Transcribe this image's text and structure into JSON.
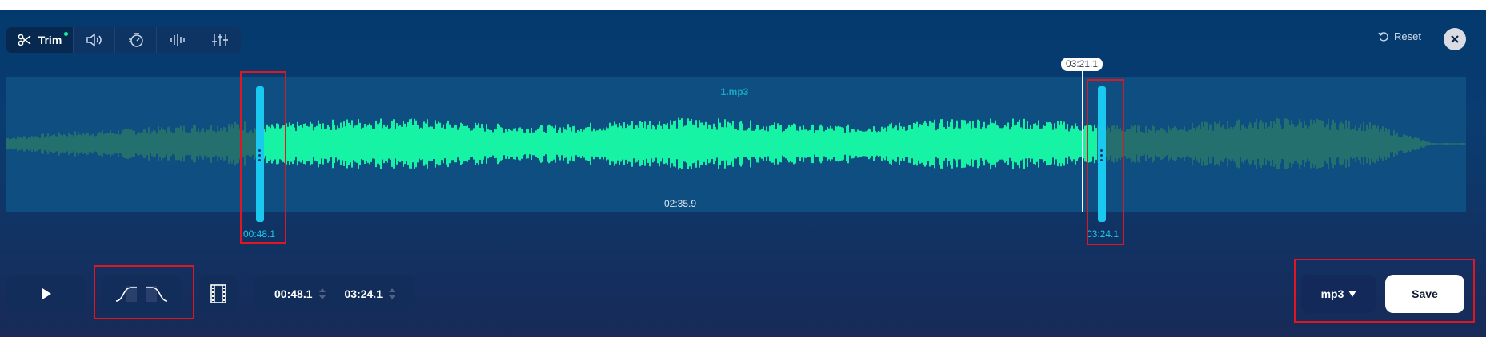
{
  "toolbar": {
    "trim_label": "Trim",
    "icons": [
      "scissors-icon",
      "volume-icon",
      "speed-icon",
      "equalizer-bars-icon",
      "sliders-icon"
    ]
  },
  "header": {
    "reset_label": "Reset",
    "close_icon": "close-icon"
  },
  "track": {
    "file_name": "1.mp3",
    "selection_duration": "02:35.9",
    "start_time": "00:48.1",
    "end_time": "03:24.1",
    "playhead_time": "03:21.1"
  },
  "controls": {
    "play_icon": "play-icon",
    "fade_in_icon": "fade-in-icon",
    "fade_out_icon": "fade-out-icon",
    "film_icon": "film-icon",
    "start_value": "00:48.1",
    "end_value": "03:24.1"
  },
  "export": {
    "format": "mp3",
    "save_label": "Save"
  },
  "colors": {
    "accent": "#19c9ef",
    "wave_selected": "#16f3a4",
    "wave_unselected": "#24706e",
    "highlight_box": "#e01720"
  }
}
